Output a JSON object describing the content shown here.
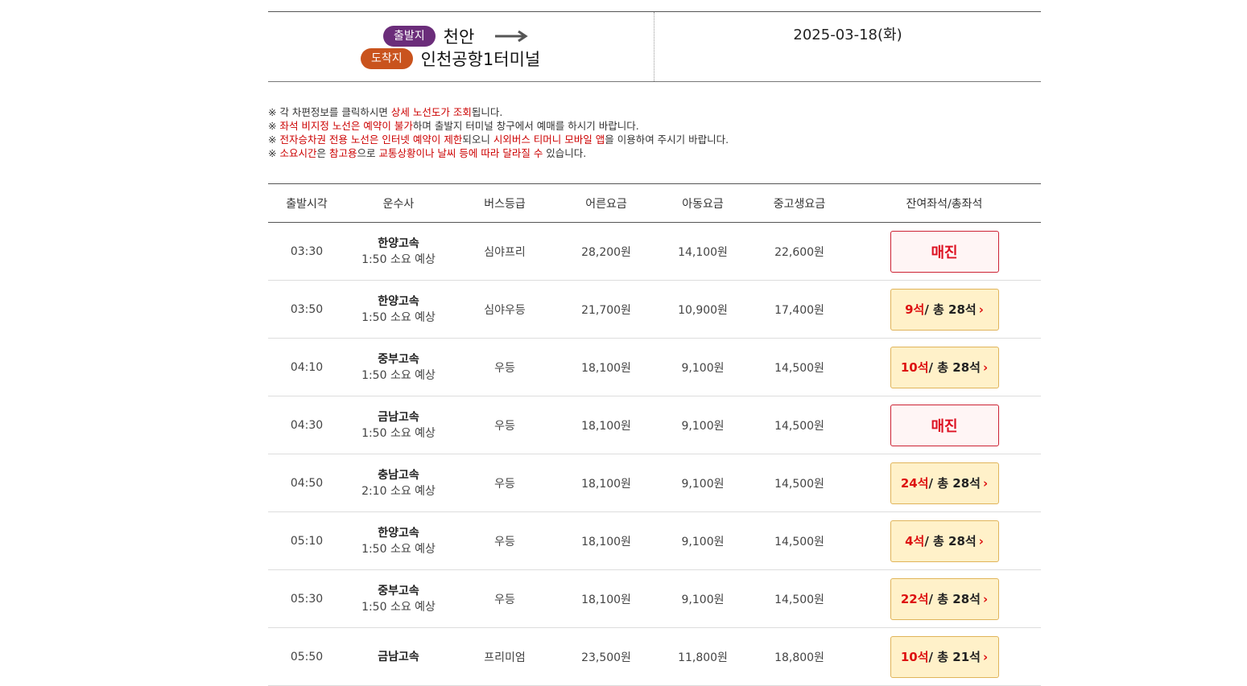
{
  "route": {
    "departure_label": "출발지",
    "departure": "천안",
    "arrival_label": "도착지",
    "arrival": "인천공항1터미널",
    "date": "2025-03-18(화)"
  },
  "notices": [
    [
      {
        "t": "※ 각 차편정보를 클릭하시면 ",
        "r": false
      },
      {
        "t": "상세 노선도가 조회",
        "r": true
      },
      {
        "t": "됩니다.",
        "r": false
      }
    ],
    [
      {
        "t": "※ ",
        "r": false
      },
      {
        "t": "좌석 비지정 노선은 예약이 불가",
        "r": true
      },
      {
        "t": "하며 출발지 터미널 창구에서 예매를 하시기 바랍니다.",
        "r": false
      }
    ],
    [
      {
        "t": "※ ",
        "r": false
      },
      {
        "t": "전자승차권 전용 노선은 인터넷 예약이 제한",
        "r": true
      },
      {
        "t": "되오니 ",
        "r": false
      },
      {
        "t": "시외버스 티머니 모바일 앱",
        "r": true
      },
      {
        "t": "을 이용하여 주시기 바랍니다.",
        "r": false
      }
    ],
    [
      {
        "t": "※ ",
        "r": false
      },
      {
        "t": "소요시간",
        "r": true
      },
      {
        "t": "은 ",
        "r": false
      },
      {
        "t": "참고용",
        "r": true
      },
      {
        "t": "으로 ",
        "r": false
      },
      {
        "t": "교통상황이나 날씨 등에 따라 달라질 수",
        "r": true
      },
      {
        "t": " 있습니다.",
        "r": false
      }
    ]
  ],
  "table": {
    "headers": [
      "출발시각",
      "운수사",
      "버스등급",
      "어른요금",
      "아동요금",
      "중고생요금",
      "잔여좌석/총좌석"
    ],
    "rows": [
      {
        "time": "03:30",
        "company": "한양고속",
        "duration": "1:50 소요 예상",
        "grade": "심야프리",
        "adult": "28,200원",
        "child": "14,100원",
        "student": "22,600원",
        "soldout": true,
        "soldout_label": "매진"
      },
      {
        "time": "03:50",
        "company": "한양고속",
        "duration": "1:50 소요 예상",
        "grade": "심야우등",
        "adult": "21,700원",
        "child": "10,900원",
        "student": "17,400원",
        "soldout": false,
        "remaining": "9석",
        "total": " / 총 28석"
      },
      {
        "time": "04:10",
        "company": "중부고속",
        "duration": "1:50 소요 예상",
        "grade": "우등",
        "adult": "18,100원",
        "child": "9,100원",
        "student": "14,500원",
        "soldout": false,
        "remaining": "10석",
        "total": " / 총 28석"
      },
      {
        "time": "04:30",
        "company": "금남고속",
        "duration": "1:50 소요 예상",
        "grade": "우등",
        "adult": "18,100원",
        "child": "9,100원",
        "student": "14,500원",
        "soldout": true,
        "soldout_label": "매진"
      },
      {
        "time": "04:50",
        "company": "충남고속",
        "duration": "2:10 소요 예상",
        "grade": "우등",
        "adult": "18,100원",
        "child": "9,100원",
        "student": "14,500원",
        "soldout": false,
        "remaining": "24석",
        "total": " / 총 28석"
      },
      {
        "time": "05:10",
        "company": "한양고속",
        "duration": "1:50 소요 예상",
        "grade": "우등",
        "adult": "18,100원",
        "child": "9,100원",
        "student": "14,500원",
        "soldout": false,
        "remaining": "4석",
        "total": " / 총 28석"
      },
      {
        "time": "05:30",
        "company": "중부고속",
        "duration": "1:50 소요 예상",
        "grade": "우등",
        "adult": "18,100원",
        "child": "9,100원",
        "student": "14,500원",
        "soldout": false,
        "remaining": "22석",
        "total": " / 총 28석"
      },
      {
        "time": "05:50",
        "company": "금남고속",
        "duration": "",
        "grade": "프리미엄",
        "adult": "23,500원",
        "child": "11,800원",
        "student": "18,800원",
        "soldout": false,
        "remaining": "10석",
        "total": " / 총 21석"
      }
    ]
  },
  "colors": {
    "departure_pill": "#6b2d7a",
    "arrival_pill": "#c9531d",
    "highlight_red": "#cc0000",
    "available_bg": "#fff1c9",
    "soldout_border": "#cc2233"
  },
  "icons": {
    "route_arrow": "right-arrow-icon",
    "seat_chevron": "chevron-right-icon"
  }
}
